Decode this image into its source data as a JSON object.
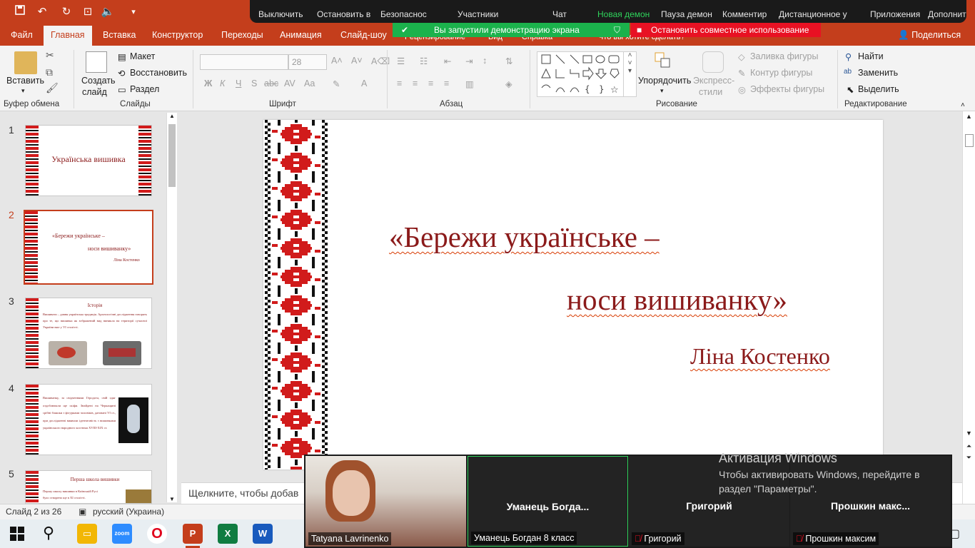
{
  "window": {
    "title": "PowerPoint"
  },
  "zoom_toolbar": {
    "items": [
      {
        "label": "Выключить"
      },
      {
        "label": "Остановить в"
      },
      {
        "label": "Безопаснос"
      },
      {
        "label": "Участники"
      },
      {
        "label": "Чат"
      },
      {
        "label": "Новая демон"
      },
      {
        "label": "Пауза демон"
      },
      {
        "label": "Комментир"
      },
      {
        "label": "Дистанционное у"
      },
      {
        "label": "Приложения"
      },
      {
        "label": "Дополнит"
      }
    ]
  },
  "sharing": {
    "status": "Вы запустили демонстрацию экрана",
    "stop": "Остановить совместное использование"
  },
  "ribbon_tabs": [
    "Файл",
    "Главная",
    "Вставка",
    "Конструктор",
    "Переходы",
    "Анимация",
    "Слайд-шоу"
  ],
  "ribbon_tabs_hidden_fragments": [
    "Рецензирование",
    "Вид",
    "Справка",
    "Что вы хотите сделать?"
  ],
  "share_button": "Поделиться",
  "ribbon": {
    "clipboard": {
      "paste": "Вставить",
      "group": "Буфер обмена"
    },
    "slides": {
      "new_slide": "Создать",
      "new_slide_2": "слайд",
      "layout": "Макет",
      "reset": "Восстановить",
      "section": "Раздел",
      "group": "Слайды"
    },
    "font": {
      "size": "28",
      "group": "Шрифт"
    },
    "paragraph": {
      "group": "Абзац"
    },
    "drawing": {
      "arrange": "Упорядочить",
      "quick_styles": "Экспресс-",
      "quick_styles_2": "стили",
      "fill": "Заливка фигуры",
      "outline": "Контур фигуры",
      "effects": "Эффекты фигуры",
      "group": "Рисование"
    },
    "editing": {
      "find": "Найти",
      "replace": "Заменить",
      "select": "Выделить",
      "group": "Редактирование"
    }
  },
  "thumbnails": [
    {
      "num": "1",
      "title": "Українська вишивка"
    },
    {
      "num": "2",
      "line1": "«Бережи українське –",
      "line2": "носи вишиванку»",
      "author": "Ліна Костенко"
    },
    {
      "num": "3",
      "title": "Історія",
      "body": "Вишивати – давня українська традиція. Археологічні дослідження говорять про те, що вишивка як зображений вид виникла на території сучасної України вже у VI столітті."
    },
    {
      "num": "4",
      "body": "Вишиванку, за свідченнями Геродота, свій одяг оздоблювали ще скіфи. Знайдені на Черкащині срібні бляшки з фігурками чоловіків, датовані VI ст., при дослідженні виявили ідентичність з вишивками українського народного костюма XVIII-XIX ст."
    },
    {
      "num": "5",
      "title": "Перша школа вишивки",
      "body": "Першу школу вишивки в Київській Русі було створено ще в XI столітті."
    }
  ],
  "slide": {
    "line1": "«Бережи українське –",
    "line2": "носи вишиванку»",
    "author": "Ліна Костенко"
  },
  "notes_placeholder": "Щелкните, чтобы добав",
  "status": {
    "slide": "Слайд 2 из 26",
    "language": "русский (Украина)"
  },
  "participants": [
    {
      "tile_name": "",
      "label": "Tatyana Lavrinenko",
      "muted": false
    },
    {
      "tile_name": "Уманець  Богда...",
      "label": "Уманець Богдан 8 класс",
      "muted": false
    },
    {
      "tile_name": "Григорий",
      "label": "Григорий",
      "muted": true
    },
    {
      "tile_name": "Прошкин  макс...",
      "label": "Прошкин максим",
      "muted": true
    }
  ],
  "activation": {
    "title": "Активация Windows",
    "line1": "Чтобы активировать Windows, перейдите в",
    "line2": "раздел \"Параметры\"."
  },
  "taskbar": {
    "apps": [
      "Windows",
      "Search",
      "File Explorer",
      "Zoom",
      "Opera",
      "PowerPoint",
      "Excel",
      "Word"
    ]
  },
  "colors": {
    "accent": "#c43e1c",
    "slide_text": "#8b1a1a",
    "zoom_green": "#1bb24c",
    "stop_red": "#e81123"
  }
}
